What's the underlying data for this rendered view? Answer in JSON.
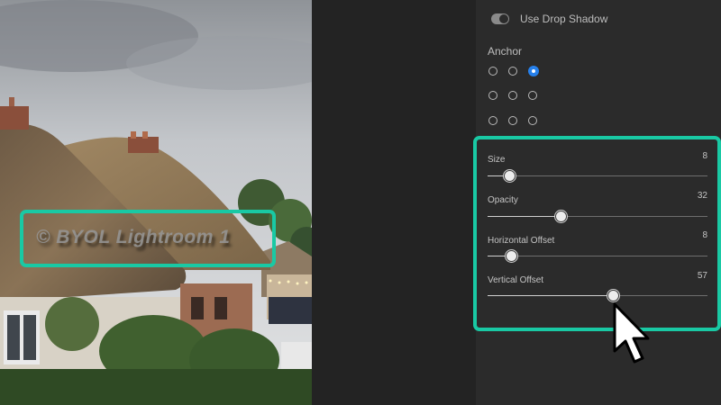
{
  "photo": {
    "watermark_text": "© BYOL Lightroom 1"
  },
  "panel": {
    "drop_shadow_label": "Use Drop Shadow",
    "drop_shadow_enabled": true,
    "anchor_label": "Anchor",
    "anchor_selected": "top-right",
    "sliders": [
      {
        "label": "Size",
        "value": "8",
        "fraction": 0.08
      },
      {
        "label": "Opacity",
        "value": "32",
        "fraction": 0.32
      },
      {
        "label": "Horizontal Offset",
        "value": "8",
        "fraction": 0.08
      },
      {
        "label": "Vertical Offset",
        "value": "57",
        "fraction": 0.57
      }
    ]
  },
  "colors": {
    "highlight": "#19c9a4",
    "accent": "#2680eb",
    "panel_bg": "#2b2b2b"
  }
}
